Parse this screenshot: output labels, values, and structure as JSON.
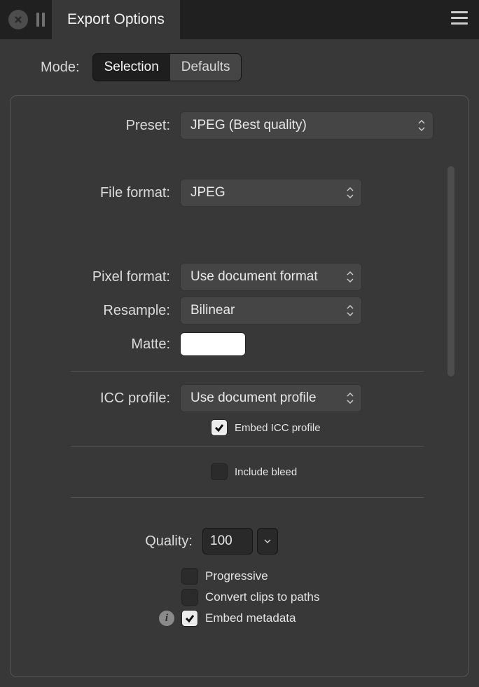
{
  "titlebar": {
    "tab": "Export Options"
  },
  "mode": {
    "label": "Mode:",
    "options": {
      "selection": "Selection",
      "defaults": "Defaults"
    }
  },
  "preset": {
    "label": "Preset:",
    "value": "JPEG (Best quality)"
  },
  "file_format": {
    "label": "File format:",
    "value": "JPEG"
  },
  "pixel_format": {
    "label": "Pixel format:",
    "value": "Use document format"
  },
  "resample": {
    "label": "Resample:",
    "value": "Bilinear"
  },
  "matte": {
    "label": "Matte:"
  },
  "icc_profile": {
    "label": "ICC profile:",
    "value": "Use document profile"
  },
  "embed_icc": {
    "label": "Embed ICC profile",
    "checked": true
  },
  "include_bleed": {
    "label": "Include bleed",
    "checked": false
  },
  "quality": {
    "label": "Quality:",
    "value": "100"
  },
  "progressive": {
    "label": "Progressive",
    "checked": false
  },
  "convert_clips": {
    "label": "Convert clips to paths",
    "checked": false
  },
  "embed_metadata": {
    "label": "Embed metadata",
    "checked": true
  }
}
